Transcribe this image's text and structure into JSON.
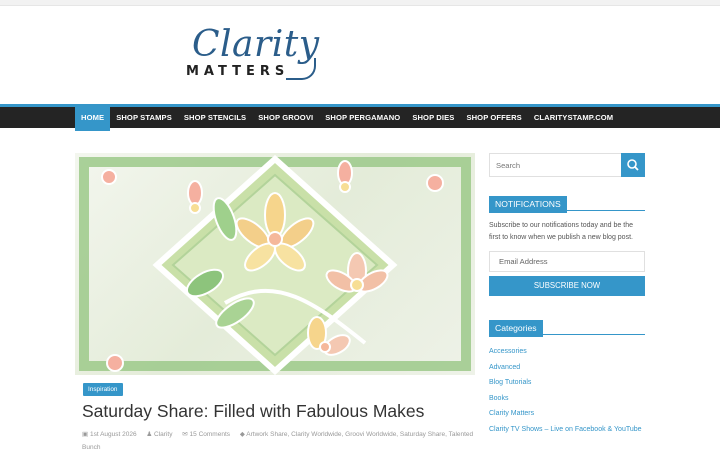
{
  "logo": {
    "script": "Clarity",
    "word": "MATTERS"
  },
  "nav": [
    "HOME",
    "SHOP STAMPS",
    "SHOP STENCILS",
    "SHOP GROOVI",
    "SHOP PERGAMANO",
    "SHOP DIES",
    "SHOP OFFERS",
    "CLARITYSTAMP.COM"
  ],
  "post": {
    "category": "Inspiration",
    "title": "Saturday Share: Filled with Fabulous Makes",
    "date": "1st August 2026",
    "author": "Clarity",
    "comments": "15 Comments",
    "tags": "Artwork Share, Clarity Worldwide, Groovi Worldwide, Saturday Share, Talented Bunch"
  },
  "sidebar": {
    "search_placeholder": "Search",
    "notifications_title": "NOTIFICATIONS",
    "notifications_text": "Subscribe to our notifications today and be the first to know when we publish a new blog post.",
    "email_placeholder": "Email Address",
    "subscribe_label": "SUBSCRIBE NOW",
    "categories_title": "Categories",
    "categories": [
      "Accessories",
      "Advanced",
      "Blog Tutorials",
      "Books",
      "Clarity Matters",
      "Clarity TV Shows – Live on Facebook & YouTube"
    ]
  },
  "colors": {
    "accent": "#3596c9",
    "nav_bg": "#242424"
  }
}
